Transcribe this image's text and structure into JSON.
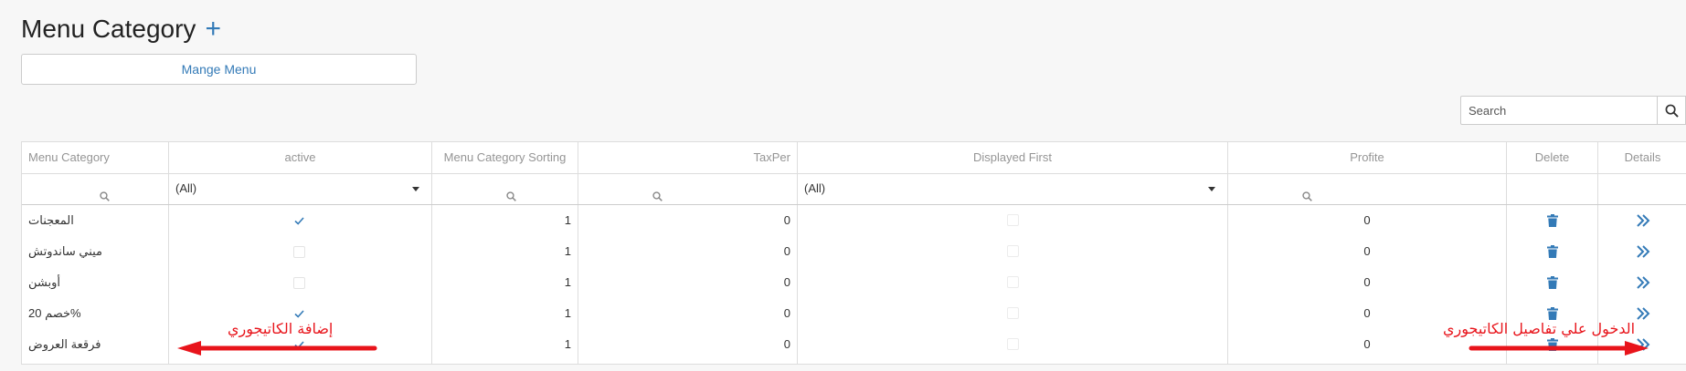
{
  "page": {
    "title": "Menu Category",
    "add_symbol": "+",
    "manage_button": "Mange Menu"
  },
  "search": {
    "placeholder": "Search"
  },
  "grid": {
    "columns": [
      {
        "label": "Menu Category"
      },
      {
        "label": "active"
      },
      {
        "label": "Menu Category Sorting"
      },
      {
        "label": "TaxPer"
      },
      {
        "label": "Displayed First"
      },
      {
        "label": "Profite"
      },
      {
        "label": "Delete"
      },
      {
        "label": "Details"
      }
    ],
    "filters": {
      "active_value": "(All)",
      "displayed_first_value": "(All)"
    },
    "rows": [
      {
        "name": "المعجنات",
        "active": true,
        "sorting": "1",
        "tax": "0",
        "displayed_first": false,
        "profit": "0"
      },
      {
        "name": "ميني ساندوتش",
        "active": false,
        "sorting": "1",
        "tax": "0",
        "displayed_first": false,
        "profit": "0"
      },
      {
        "name": "أوبشن",
        "active": false,
        "sorting": "1",
        "tax": "0",
        "displayed_first": false,
        "profit": "0"
      },
      {
        "name": "خصم 20%",
        "active": true,
        "sorting": "1",
        "tax": "0",
        "displayed_first": false,
        "profit": "0"
      },
      {
        "name": "فرقعة العروض",
        "active": true,
        "sorting": "1",
        "tax": "0",
        "displayed_first": false,
        "profit": "0"
      }
    ]
  },
  "annotations": {
    "left_note": "إضافة الكاتيجوري",
    "right_note": "الدخول علي تفاصيل الكاتيجوري"
  },
  "colors": {
    "accent": "#337ab7",
    "annotation": "#e8141b"
  },
  "icons": {
    "add": "plus-icon",
    "search": "search-icon",
    "filter": "search-icon",
    "delete": "trash-icon",
    "details": "double-chevron-right-icon",
    "active": "checkmark-icon"
  }
}
